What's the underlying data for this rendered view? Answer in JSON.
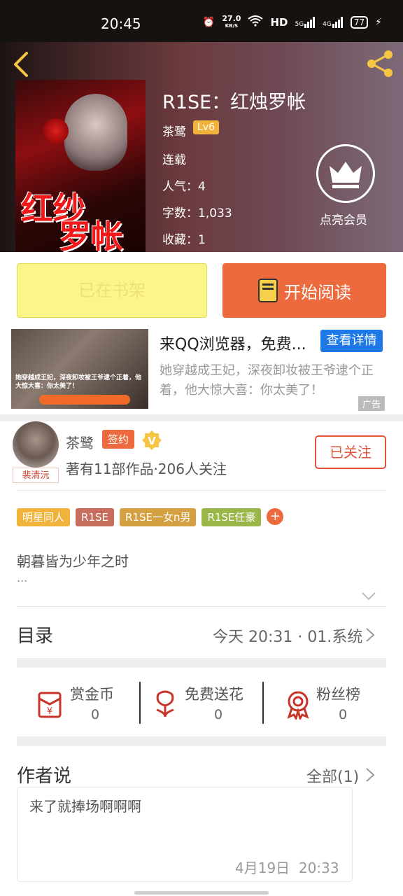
{
  "status_bar": {
    "time": "20:45",
    "net_speed": "27.0",
    "net_unit": "KB/S",
    "hd": "HD",
    "five_g": "5G",
    "four_g": "4G",
    "battery": "77"
  },
  "book": {
    "title": "R1SE：红烛罗帐",
    "author": "茶鹭",
    "level": "Lv6",
    "status": "连载",
    "popularity": "人气：4",
    "word_count": "字数：1,033",
    "favorites": "收藏：1",
    "cover_title_line1": "红纱",
    "cover_title_line2": "罗帐",
    "vip_label": "点亮会员"
  },
  "actions": {
    "shelf_label": "已在书架",
    "read_label": "开始阅读"
  },
  "ad": {
    "title": "来QQ浏览器，免费...",
    "button": "查看详情",
    "description": "她穿越成王妃，深夜卸妆被王爷逮个正着，他大惊大喜：你太美了！",
    "tag": "广告",
    "image_caption": "她穿越成王妃，深夜卸妆被王爷逮个正着，他大惊大喜：你太美了！"
  },
  "author_card": {
    "name": "茶鹭",
    "signed_badge": "签约",
    "works_line": "著有11部作品·206人关注",
    "follow_label": "已关注",
    "avatar_tag": "裴清沅"
  },
  "tags": [
    {
      "label": "明星同人",
      "color": "#f2b33d"
    },
    {
      "label": "R1SE",
      "color": "#c66d5e"
    },
    {
      "label": "R1SE一女n男",
      "color": "#d4a041"
    },
    {
      "label": "R1SE任豪",
      "color": "#9bb648"
    }
  ],
  "tag_more": "+",
  "intro": {
    "text": "朝暮皆为少年之时",
    "ellipsis": "..."
  },
  "catalog": {
    "title": "目录",
    "latest": "今天 20:31 · 01.系统"
  },
  "stats": [
    {
      "label": "赏金币",
      "value": "0",
      "icon": "red-envelope-icon"
    },
    {
      "label": "免费送花",
      "value": "0",
      "icon": "flower-icon"
    },
    {
      "label": "粉丝榜",
      "value": "0",
      "icon": "medal-icon"
    }
  ],
  "author_says": {
    "title": "作者说",
    "all_label": "全部(1)",
    "comment": "来了就捧场啊啊啊",
    "date": "4月19日",
    "time": "20:33"
  },
  "colors": {
    "accent": "#ec6a3d",
    "shelf_bg": "#fbf68a",
    "ad_button": "#1d79e8",
    "follow": "#e0553a"
  }
}
